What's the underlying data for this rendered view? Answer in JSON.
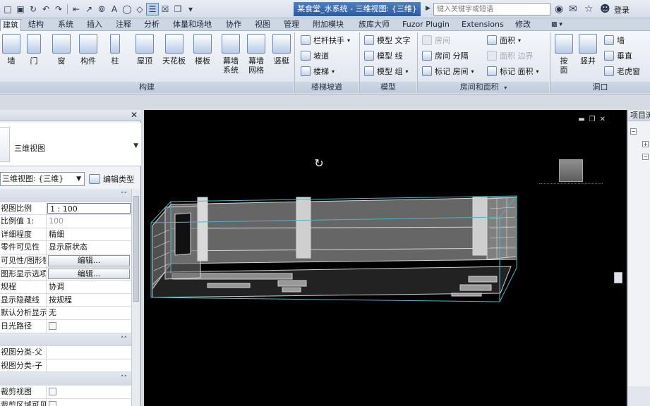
{
  "titlebar": {
    "title": "某食堂_水系统 - 三维视图: {三维}",
    "search_placeholder": "键入关键字或短语",
    "login": "登录"
  },
  "tabs": [
    {
      "label": "建筑",
      "active": true
    },
    {
      "label": "结构"
    },
    {
      "label": "系统"
    },
    {
      "label": "插入"
    },
    {
      "label": "注释"
    },
    {
      "label": "分析"
    },
    {
      "label": "体量和场地"
    },
    {
      "label": "协作"
    },
    {
      "label": "视图"
    },
    {
      "label": "管理"
    },
    {
      "label": "附加模块"
    },
    {
      "label": "族库大师"
    },
    {
      "label": "Fuzor Plugin"
    },
    {
      "label": "Extensions"
    },
    {
      "label": "修改"
    }
  ],
  "ribbon": {
    "build_buttons": [
      {
        "label": "墙"
      },
      {
        "label": "门"
      },
      {
        "label": "窗"
      },
      {
        "label": "构件"
      },
      {
        "label": "柱"
      },
      {
        "label": "屋顶"
      },
      {
        "label": "天花板"
      },
      {
        "label": "楼板"
      },
      {
        "label": "幕墙\n系统"
      },
      {
        "label": "幕墙\n网格"
      },
      {
        "label": "竖梃"
      }
    ],
    "stairs_items": [
      {
        "label": "栏杆扶手"
      },
      {
        "label": "坡道"
      },
      {
        "label": "楼梯"
      }
    ],
    "model_items": [
      {
        "label": "模型 文字"
      },
      {
        "label": "模型 线"
      },
      {
        "label": "模型 组"
      }
    ],
    "room_items": [
      {
        "label": "房间"
      },
      {
        "label": "房间 分隔"
      },
      {
        "label": "标记 房间"
      },
      {
        "label": "面积"
      },
      {
        "label": "面积 边界"
      },
      {
        "label": "标记 面积"
      }
    ],
    "opening_buttons": [
      {
        "label": "按\n面"
      },
      {
        "label": "竖井"
      }
    ],
    "opening_small": [
      {
        "label": "墙"
      },
      {
        "label": "垂直"
      },
      {
        "label": "老虎窗"
      }
    ],
    "group_labels": {
      "build": "构建",
      "stairs": "楼梯坡道",
      "model": "模型",
      "room": "房间和面积",
      "opening": "洞口"
    }
  },
  "properties": {
    "type_name": "三维视图",
    "view_selector": "三维视图: {三维}",
    "edit_type": "编辑类型",
    "rows": [
      {
        "kind": "section"
      },
      {
        "name": "视图比例",
        "value": "1 : 100",
        "style": "framed"
      },
      {
        "name": "比例值 1:",
        "value": "100",
        "style": "grey"
      },
      {
        "name": "详细程度",
        "value": "精细"
      },
      {
        "name": "零件可见性",
        "value": "显示原状态"
      },
      {
        "name": "可见性/图形替换",
        "value": "编辑...",
        "style": "button"
      },
      {
        "name": "图形显示选项",
        "value": "编辑...",
        "style": "button"
      },
      {
        "name": "规程",
        "value": "协调"
      },
      {
        "name": "显示隐藏线",
        "value": "按规程"
      },
      {
        "name": "默认分析显示样式",
        "value": "无"
      },
      {
        "name": "日光路径",
        "value": "",
        "style": "check"
      },
      {
        "kind": "section"
      },
      {
        "name": "视图分类-父",
        "value": ""
      },
      {
        "name": "视图分类-子",
        "value": ""
      },
      {
        "kind": "section"
      },
      {
        "name": "裁剪视图",
        "value": "",
        "style": "check"
      },
      {
        "name": "裁剪区域可见",
        "value": "",
        "style": "check"
      }
    ]
  },
  "browser": {
    "title": "项目浏览器"
  },
  "colors": {
    "accent": "#2c5b9f",
    "viewport_bg": "#000000",
    "model_line": "#d0d0d0",
    "model_edge": "#4fb6c9"
  }
}
